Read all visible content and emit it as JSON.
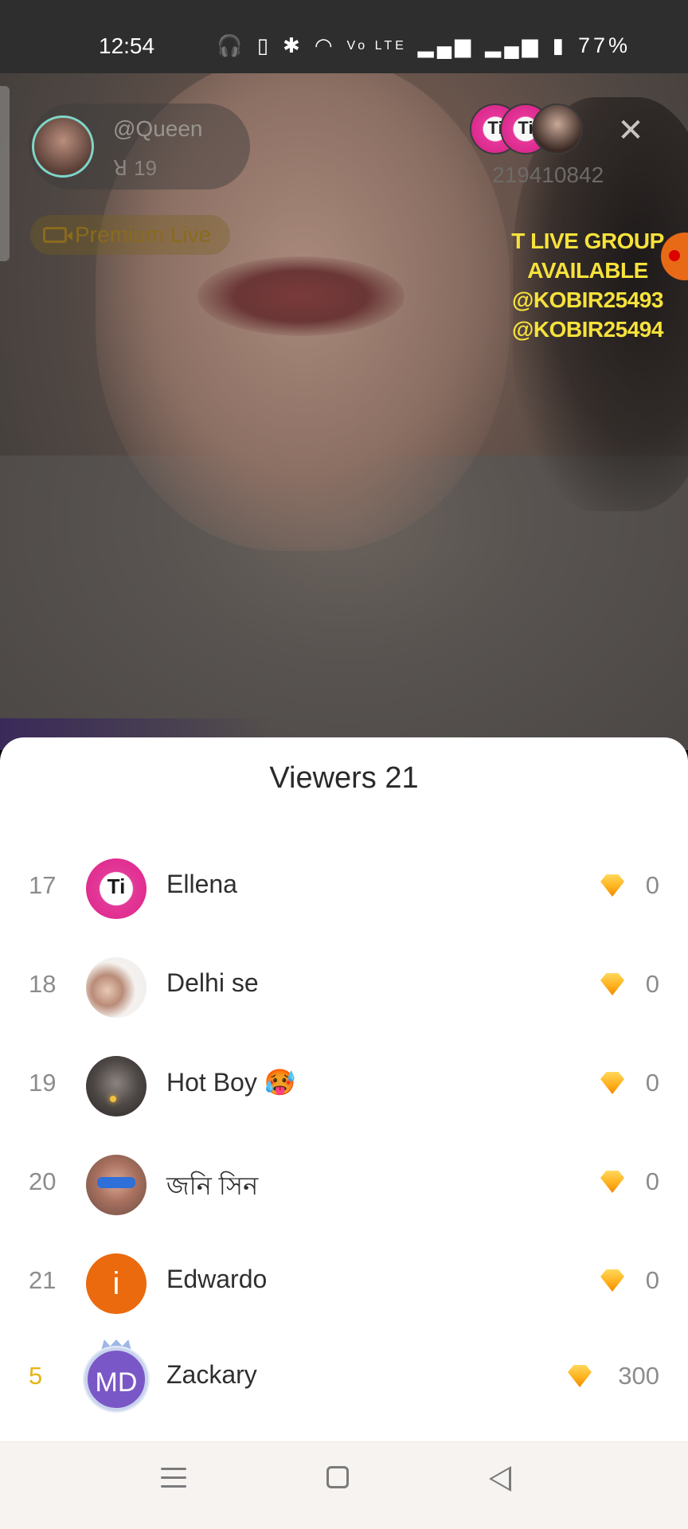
{
  "status_bar": {
    "time": "12:54",
    "icons": [
      "headphones-icon",
      "vibrate-icon",
      "bluetooth-icon",
      "wifi-icon",
      "volte-icon",
      "signal-icon",
      "signal-icon"
    ],
    "battery": "77%"
  },
  "live": {
    "host_name": "@Queen",
    "viewer_count": "19",
    "premium_label": "Premium Live",
    "room_id": "219410842",
    "mini_avatar_label": "Ti",
    "promo_lines": [
      "T LIVE GROUP",
      "AVAILABLE",
      "@KOBIR25493",
      "@KOBIR25494"
    ]
  },
  "viewers_sheet": {
    "title": "Viewers 21",
    "rows": [
      {
        "rank": "17",
        "name": "Ellena",
        "coins": "0",
        "avatar": "tlive-logo",
        "avatar_text": "Ti"
      },
      {
        "rank": "18",
        "name": "Delhi se",
        "coins": "0",
        "avatar": "couple-photo"
      },
      {
        "rank": "19",
        "name": "Hot Boy 🥵",
        "coins": "0",
        "avatar": "dark-photo"
      },
      {
        "rank": "20",
        "name": "জনি সিন",
        "coins": "0",
        "avatar": "sunglasses-photo"
      },
      {
        "rank": "21",
        "name": "Edwardo",
        "coins": "0",
        "avatar": "letter",
        "avatar_text": "i"
      },
      {
        "rank": "5",
        "name": "Zackary",
        "coins": "300",
        "avatar": "initials",
        "avatar_text": "MD"
      }
    ]
  },
  "colors": {
    "promo_text": "#f7e23c",
    "gold_rank": "#e7b318",
    "orange_avatar": "#ea6a0d",
    "purple_avatar": "#7a57c6"
  }
}
